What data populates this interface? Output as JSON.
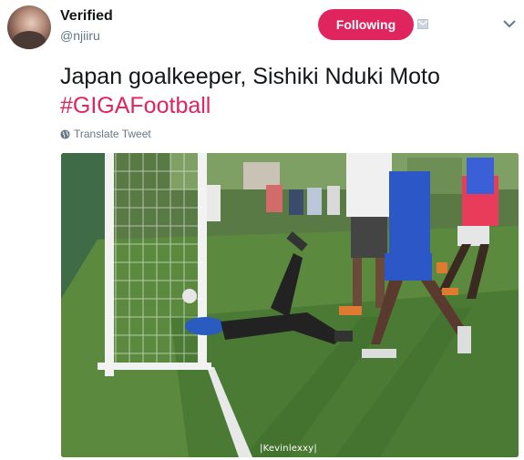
{
  "user": {
    "name": "Verified",
    "handle": "@njiiru"
  },
  "actions": {
    "follow_label": "Following"
  },
  "tweet": {
    "text": "Japan goalkeeper, Sishiki Nduki Moto",
    "hashtag": "#GIGAFootball",
    "translate_label": "Translate Tweet"
  },
  "media": {
    "watermark": "|Kevinlexxy|"
  },
  "colors": {
    "accent": "#e0245e",
    "secondary_text": "#657786"
  },
  "icons": [
    "avatar",
    "mail-icon",
    "chevron-down-icon",
    "globe-icon"
  ]
}
